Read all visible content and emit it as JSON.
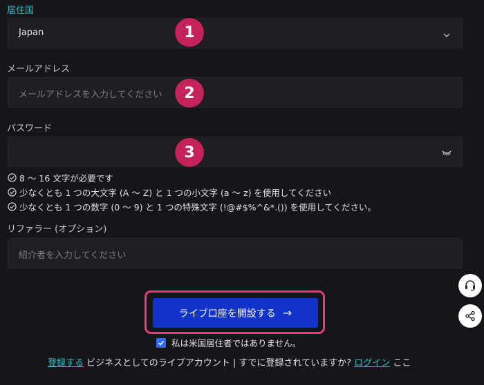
{
  "country": {
    "label": "居住国",
    "value": "Japan"
  },
  "email": {
    "label": "メールアドレス",
    "placeholder": "メールアドレスを入力してください"
  },
  "password": {
    "label": "パスワード",
    "rules": [
      "8 〜 16 文字が必要です",
      "少なくとも 1 つの大文字 (A 〜 Z) と 1 つの小文字 (a 〜 z) を使用してください",
      "少なくとも 1 つの数字 (0 〜 9) と 1 つの特殊文字 (!@#$%^&*.()) を使用してください。"
    ]
  },
  "referrer": {
    "label": "リファラー (オプション)",
    "placeholder": "紹介者を入力してください"
  },
  "markers": [
    "1",
    "2",
    "3"
  ],
  "submit": {
    "label": "ライブ口座を開設する",
    "arrow": "→"
  },
  "us_resident_checkbox": {
    "label": "私は米国居住者ではありません。",
    "checked": true
  },
  "footer": {
    "register_link": "登録する",
    "middle_text": " ビジネスとしてのライブアカウント | すでに登録されていますか? ",
    "login_link": "ログイン",
    "tail_text": " ここ"
  },
  "colors": {
    "accent_teal": "#2bc0c7",
    "button_blue": "#1133c9",
    "marker_red": "#c4235a",
    "highlight_pink": "#ea3a78"
  },
  "icons": {
    "dropdown": "chevron-down-icon",
    "password_visibility": "eye-closed-icon",
    "rule_check": "check-circle-icon",
    "support": "headset-icon",
    "share": "share-icon"
  }
}
